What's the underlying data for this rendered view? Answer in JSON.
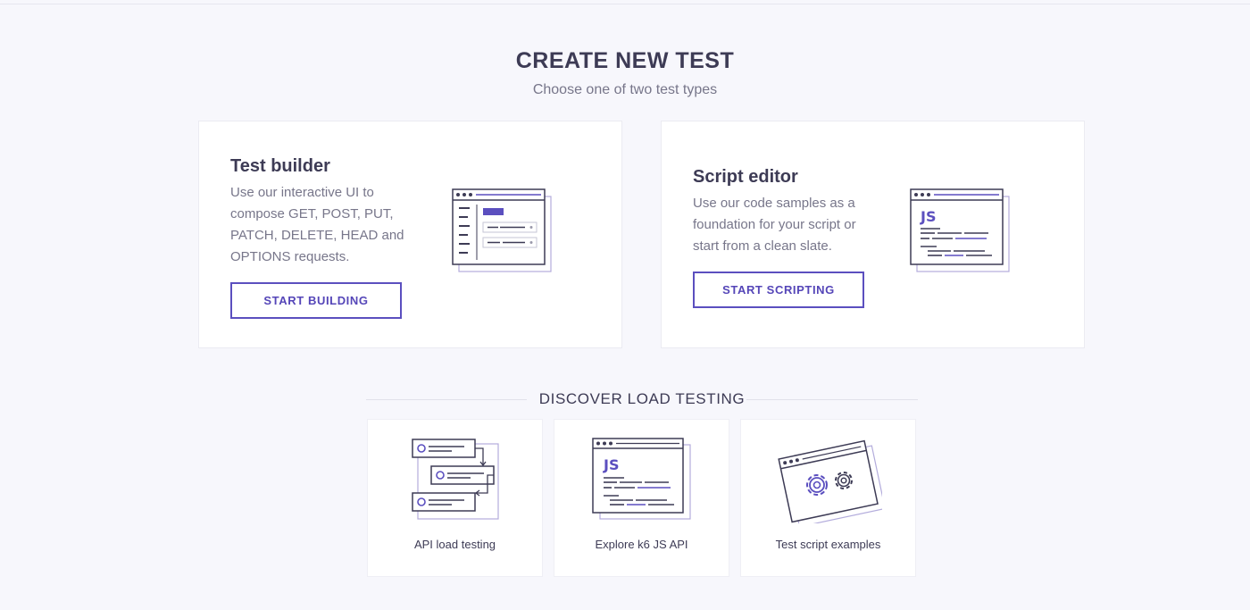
{
  "page": {
    "title": "CREATE NEW TEST",
    "subtitle": "Choose one of two test types"
  },
  "cards": {
    "builder": {
      "title": "Test builder",
      "description": "Use our interactive UI to compose GET, POST, PUT, PATCH, DELETE, HEAD and OPTIONS requests.",
      "button_label": "START BUILDING",
      "illustration": "test-builder-illustration"
    },
    "editor": {
      "title": "Script editor",
      "description": "Use our code samples as a foundation for your script or start from a clean slate.",
      "button_label": "START SCRIPTING",
      "illustration": "script-editor-illustration",
      "code_badge": "JS"
    }
  },
  "discover": {
    "title": "DISCOVER LOAD TESTING",
    "tiles": [
      {
        "label": "API load testing",
        "illustration": "api-flow-illustration"
      },
      {
        "label": "Explore k6 JS API",
        "illustration": "js-editor-illustration",
        "code_badge": "JS"
      },
      {
        "label": "Test script examples",
        "illustration": "gears-window-illustration"
      }
    ]
  },
  "colors": {
    "background": "#f7f7fc",
    "accent": "#5b4fbf",
    "heading": "#3d3b55",
    "muted_text": "#77768a",
    "card": "#ffffff"
  }
}
